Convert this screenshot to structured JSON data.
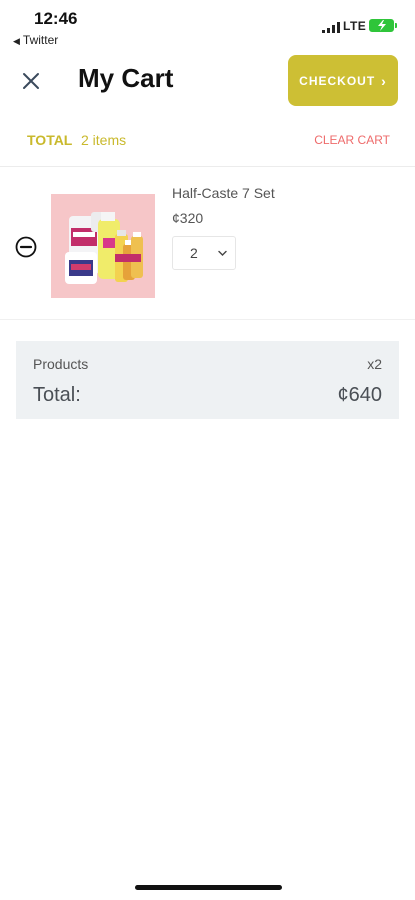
{
  "status_bar": {
    "time": "12:46",
    "back_app": "Twitter",
    "network": "LTE"
  },
  "header": {
    "title": "My Cart",
    "checkout_label": "CHECKOUT",
    "checkout_color": "#cdbf34"
  },
  "summary_bar": {
    "total_label": "TOTAL",
    "items_count": "2 items",
    "clear_cart_label": "CLEAR CART",
    "accent_color": "#c9b92c",
    "clear_color": "#ee6b6b"
  },
  "cart_items": [
    {
      "name": "Half-Caste 7 Set",
      "price": "¢320",
      "quantity": "2"
    }
  ],
  "order_summary": {
    "products_label": "Products",
    "products_count": "x2",
    "total_label": "Total:",
    "total_amount": "¢640"
  },
  "icons": {
    "close": "close-icon",
    "checkout_arrow": "chevron-right-icon",
    "remove": "minus-circle-icon",
    "qty_dropdown": "chevron-down-icon"
  }
}
